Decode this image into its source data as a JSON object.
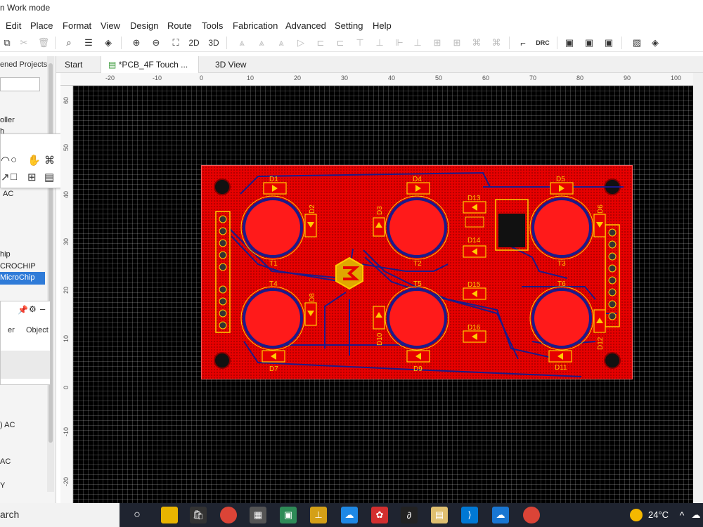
{
  "window": {
    "title": "n Work mode"
  },
  "menu": [
    "Edit",
    "Place",
    "Format",
    "View",
    "Design",
    "Route",
    "Tools",
    "Fabrication",
    "Advanced",
    "Setting",
    "Help"
  ],
  "toolbar": {
    "view2d": "2D",
    "view3d": "3D",
    "drc": "DRC"
  },
  "left_panel": {
    "header": "ened Projects",
    "items": [
      "oller",
      "h",
      "AC",
      "hip",
      "CROCHIP",
      "MicroChip",
      ") AC",
      "AC",
      "Y"
    ],
    "selected": "MicroChip",
    "prop_tabs": [
      "er",
      "Object"
    ],
    "search_label": "arch"
  },
  "tabs": [
    {
      "label": "Start"
    },
    {
      "label": "*PCB_4F Touch ..."
    },
    {
      "label": "3D View"
    }
  ],
  "ruler": {
    "top": [
      "-20",
      "-10",
      "0",
      "10",
      "20",
      "30",
      "40",
      "50",
      "60",
      "70",
      "80",
      "90",
      "100"
    ],
    "left": [
      "60",
      "50",
      "40",
      "30",
      "20",
      "10",
      "0",
      "-10",
      "-20"
    ]
  },
  "pcb": {
    "pads": [
      "T1",
      "T2",
      "T3",
      "T4",
      "T5",
      "T6"
    ],
    "leds": [
      "D1",
      "D2",
      "D3",
      "D4",
      "D5",
      "D6",
      "D7",
      "D8",
      "D9",
      "D10",
      "D11",
      "D12",
      "D13",
      "D14",
      "D15",
      "D16"
    ]
  },
  "taskbar": {
    "temperature": "24°C"
  },
  "colors": {
    "copper_top": "#e60000",
    "silkscreen": "#ffcc00",
    "bottom_track": "#1b1b8a",
    "canvas": "#000000"
  }
}
